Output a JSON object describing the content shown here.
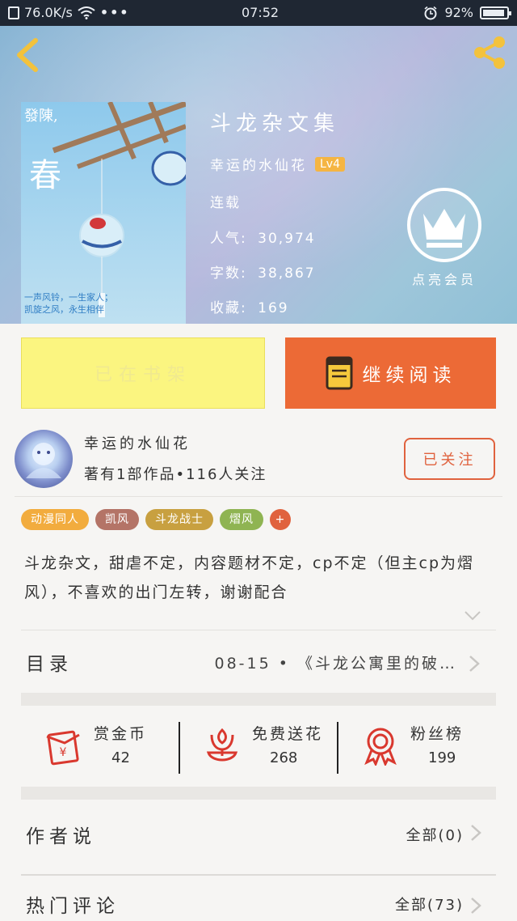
{
  "status_bar": {
    "speed": "76.0K/s",
    "time": "07:52",
    "battery": "92%",
    "battery_level": 0.92
  },
  "book": {
    "title": "斗龙杂文集",
    "author": "幸运的水仙花",
    "author_level": "Lv4",
    "status": "连载",
    "popularity_label": "人气:",
    "popularity": "30,974",
    "words_label": "字数:",
    "words": "38,867",
    "favorites_label": "收藏:",
    "favorites": "169",
    "vip_label": "点亮会员",
    "cover": {
      "top_text": "發陳,",
      "title": "春",
      "line1": "一声风铃，一生家人；",
      "line2": "凯旋之风，永生相伴"
    }
  },
  "actions": {
    "shelf_label": "已在书架",
    "read_label": "继续阅读"
  },
  "author_card": {
    "name": "幸运的水仙花",
    "stats": "著有1部作品•116人关注",
    "follow_label": "已关注"
  },
  "tags": [
    {
      "label": "动漫同人",
      "color": "#f2ac3e"
    },
    {
      "label": "凯风",
      "color": "#b47467"
    },
    {
      "label": "斗龙战士",
      "color": "#c8a040"
    },
    {
      "label": "熠风",
      "color": "#8fb452"
    },
    {
      "label": "+",
      "color": "#e0623e"
    }
  ],
  "description": "斗龙杂文，甜虐不定，内容题材不定，cp不定（但主cp为熠风），不喜欢的出门左转，谢谢配合",
  "catalog": {
    "label": "目录",
    "latest": "08-15 • 《斗龙公寓里的破…"
  },
  "stats": [
    {
      "label": "赏金币",
      "value": "42",
      "icon": "red-envelope-icon"
    },
    {
      "label": "免费送花",
      "value": "268",
      "icon": "flower-icon"
    },
    {
      "label": "粉丝榜",
      "value": "199",
      "icon": "medal-icon"
    }
  ],
  "author_says": {
    "label": "作者说",
    "more": "全部(0)"
  },
  "hot_comments": {
    "label": "热门评论",
    "more": "全部(73)"
  },
  "colors": {
    "accent": "#ec6a36",
    "shelf_button": "#fbf580",
    "follow": "#e0623e"
  }
}
